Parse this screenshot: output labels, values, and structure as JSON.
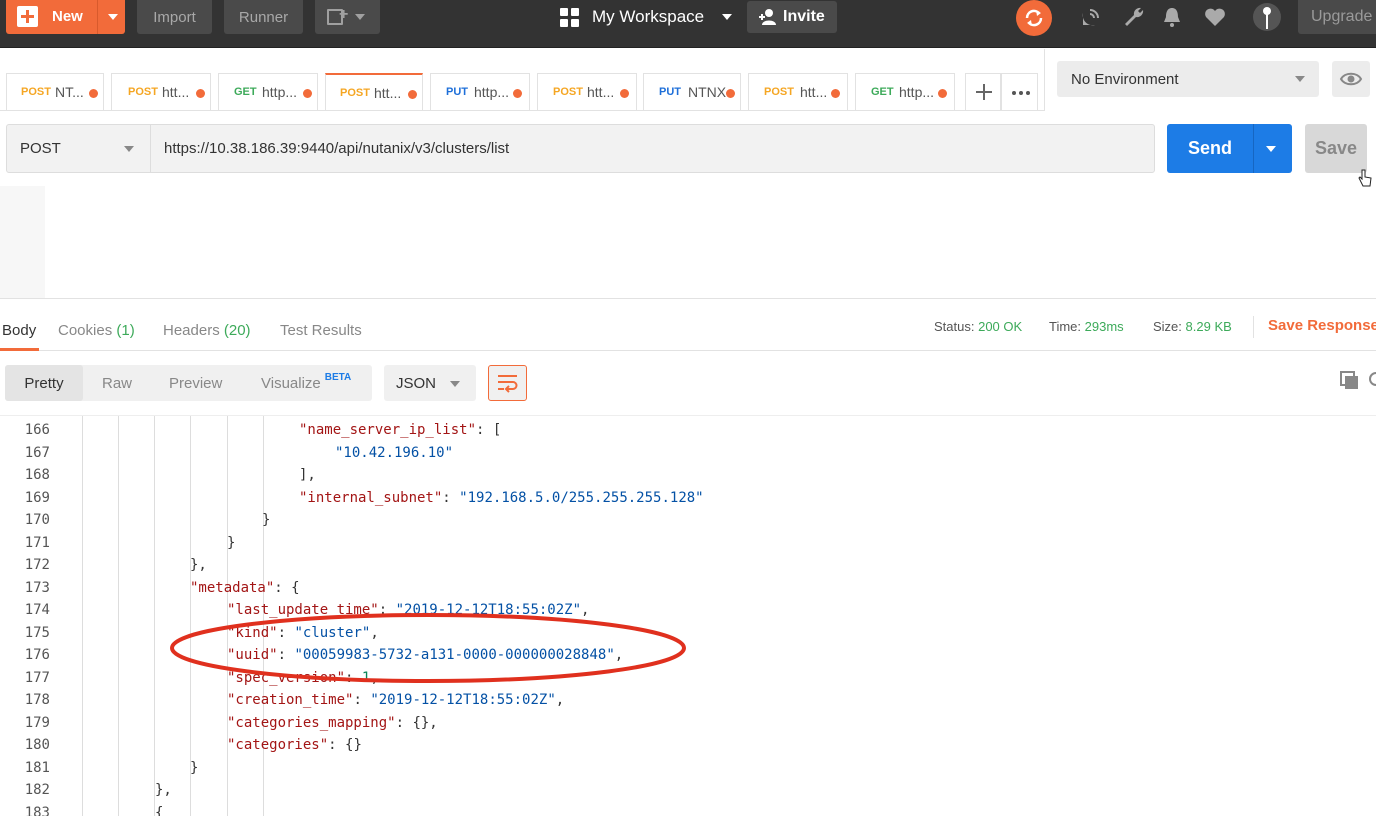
{
  "topbar": {
    "new_label": "New",
    "import_label": "Import",
    "runner_label": "Runner",
    "workspace_label": "My Workspace",
    "invite_label": "Invite",
    "upgrade_label": "Upgrade",
    "accent_color": "#f26b3a"
  },
  "tabs": [
    {
      "method": "POST",
      "title": "NT..."
    },
    {
      "method": "POST",
      "title": "htt..."
    },
    {
      "method": "GET",
      "title": "http..."
    },
    {
      "method": "POST",
      "title": "htt..."
    },
    {
      "method": "PUT",
      "title": "http..."
    },
    {
      "method": "POST",
      "title": "htt..."
    },
    {
      "method": "PUT",
      "title": "NTNX"
    },
    {
      "method": "POST",
      "title": "htt..."
    },
    {
      "method": "GET",
      "title": "http..."
    }
  ],
  "environment": {
    "selected": "No Environment"
  },
  "request": {
    "method": "POST",
    "url": "https://10.38.186.39:9440/api/nutanix/v3/clusters/list",
    "send_label": "Send",
    "save_label": "Save"
  },
  "response": {
    "tabs": {
      "body": "Body",
      "cookies": "Cookies",
      "cookies_count": "(1)",
      "headers": "Headers",
      "headers_count": "(20)",
      "tests": "Test Results"
    },
    "status_label": "Status:",
    "status_value": "200 OK",
    "time_label": "Time:",
    "time_value": "293ms",
    "size_label": "Size:",
    "size_value": "8.29 KB",
    "save_response_label": "Save Response",
    "views": {
      "pretty": "Pretty",
      "raw": "Raw",
      "preview": "Preview",
      "visualize": "Visualize",
      "beta": "BETA"
    },
    "format": "JSON"
  },
  "code_lines": [
    {
      "num": "166",
      "text": "\"name_server_ip_list\": ["
    },
    {
      "num": "167",
      "text": "\"10.42.196.10\""
    },
    {
      "num": "168",
      "text": "],"
    },
    {
      "num": "169",
      "text": "\"internal_subnet\": \"192.168.5.0/255.255.255.128\""
    },
    {
      "num": "170",
      "text": "}"
    },
    {
      "num": "171",
      "text": "}"
    },
    {
      "num": "172",
      "text": "},"
    },
    {
      "num": "173",
      "text": "\"metadata\": {"
    },
    {
      "num": "174",
      "text": "\"last_update_time\": \"2019-12-12T18:55:02Z\","
    },
    {
      "num": "175",
      "text": "\"kind\": \"cluster\","
    },
    {
      "num": "176",
      "text": "\"uuid\": \"00059983-5732-a131-0000-000000028848\","
    },
    {
      "num": "177",
      "text": "\"spec_version\": 1,"
    },
    {
      "num": "178",
      "text": "\"creation_time\": \"2019-12-12T18:55:02Z\","
    },
    {
      "num": "179",
      "text": "\"categories_mapping\": {},"
    },
    {
      "num": "180",
      "text": "\"categories\": {}"
    },
    {
      "num": "181",
      "text": "}"
    },
    {
      "num": "182",
      "text": "},"
    },
    {
      "num": "183",
      "text": "{"
    }
  ],
  "colors": {
    "key": "#a31515",
    "string": "#0451a5",
    "number": "#098658",
    "send": "#1d7ce6",
    "annotation": "#e0301e"
  }
}
